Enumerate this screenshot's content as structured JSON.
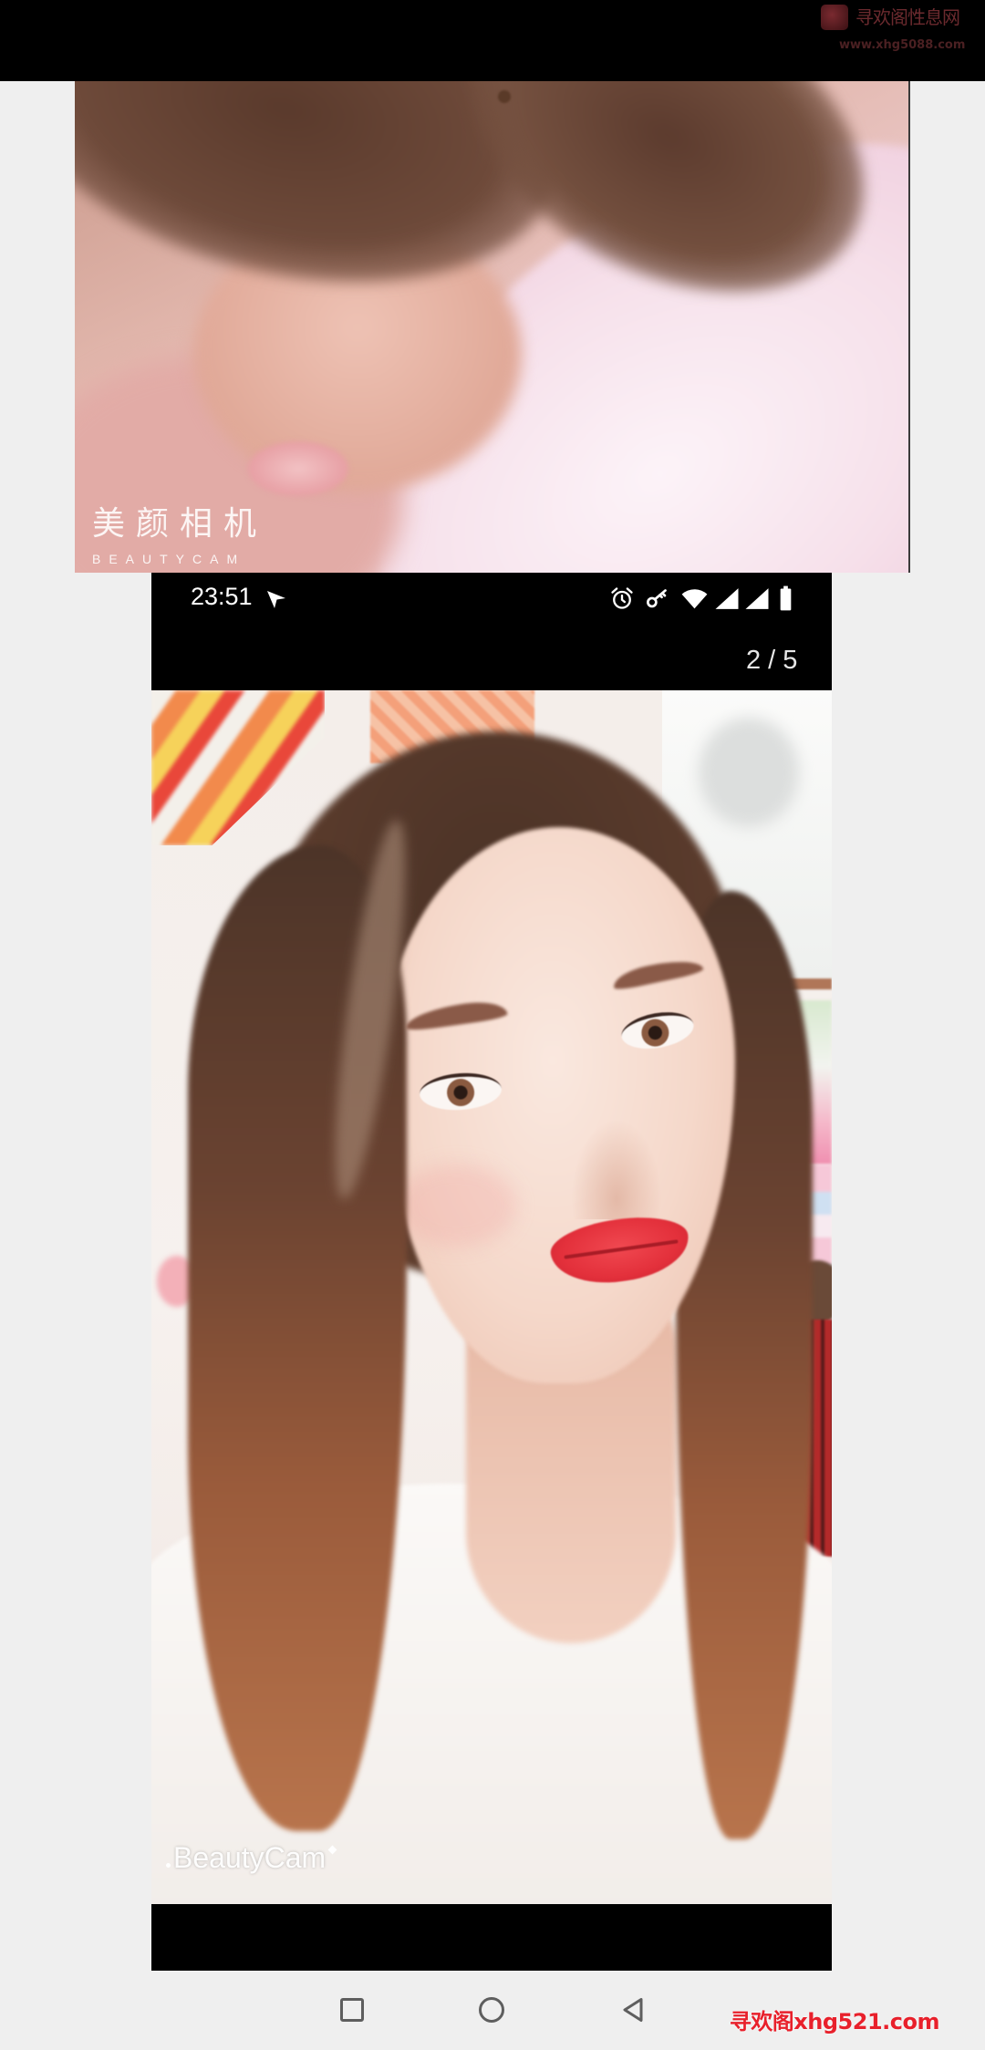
{
  "watermark_top": {
    "title": "寻欢阁性息网",
    "url": "www.xhg5088.com"
  },
  "photo1": {
    "watermark_cn": "美颜相机",
    "watermark_en": "BEAUTYCAM"
  },
  "screenshot": {
    "status_bar": {
      "time": "23:51",
      "left_icons": [
        "send-arrow-icon"
      ],
      "right_icons": [
        "alarm-icon",
        "key-icon",
        "wifi-icon",
        "signal-icon",
        "signal-icon",
        "battery-icon"
      ]
    },
    "page_counter": "2 / 5",
    "photo_watermark": "BeautyCam"
  },
  "nav_bar": {
    "buttons": [
      "recents-icon",
      "home-icon",
      "back-icon"
    ]
  },
  "watermark_bottom": "寻欢阁xhg521.com",
  "colors": {
    "page_background": "#efefef",
    "status_bar_background": "#000000",
    "watermark_bottom": "#e8202b",
    "nav_icon": "#5e5e5e"
  }
}
